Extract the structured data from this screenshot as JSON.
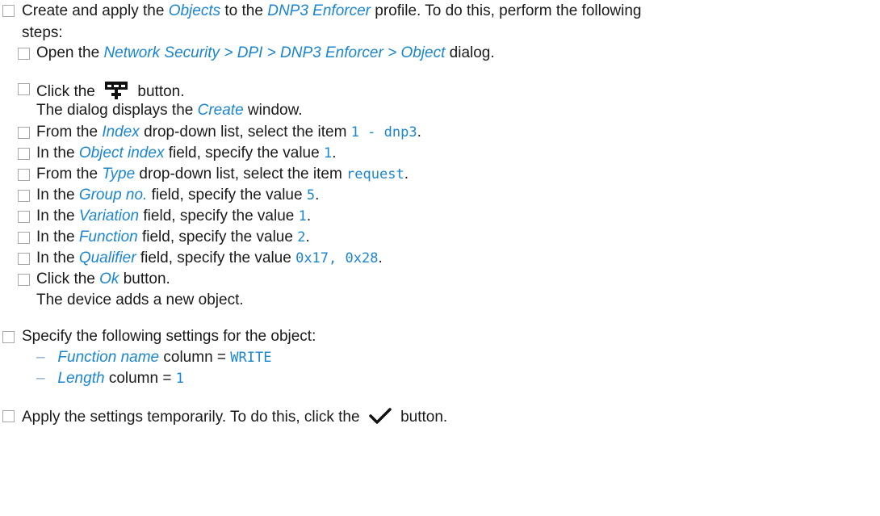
{
  "step1": {
    "line1_pre": "Create and apply the ",
    "line1_obj": "Objects",
    "line1_mid": " to the ",
    "line1_profile": "DNP3 Enforcer",
    "line1_post": " profile. To do this, perform the following",
    "line2": "steps:"
  },
  "substeps": {
    "open": {
      "pre": "Open the ",
      "path": "Network Security > DPI > DNP3 Enforcer > Object",
      "post": " dialog."
    },
    "click_add": {
      "pre": "Click the ",
      "post": " button.",
      "icon": "add-row-icon"
    },
    "dialog_note": {
      "pre": "The dialog displays the ",
      "name": "Create",
      "post": " window."
    },
    "index": {
      "pre": "From the ",
      "field": "Index",
      "mid": " drop-down list, select the item ",
      "value": "1 - dnp3",
      "post": "."
    },
    "object_index": {
      "pre": "In the ",
      "field": "Object index",
      "mid": " field, specify the value ",
      "value": "1",
      "post": "."
    },
    "type": {
      "pre": "From the ",
      "field": "Type",
      "mid": " drop-down list, select the item ",
      "value": "request",
      "post": "."
    },
    "group": {
      "pre": "In the ",
      "field": "Group no.",
      "mid": " field, specify the value ",
      "value": "5",
      "post": "."
    },
    "variation": {
      "pre": "In the ",
      "field": "Variation",
      "mid": " field, specify the value ",
      "value": "1",
      "post": "."
    },
    "function": {
      "pre": "In the ",
      "field": "Function",
      "mid": " field, specify the value ",
      "value": "2",
      "post": "."
    },
    "qualifier": {
      "pre": "In the ",
      "field": "Qualifier",
      "mid": " field, specify the value ",
      "value": "0x17, 0x28",
      "post": "."
    },
    "ok": {
      "pre": "Click the ",
      "field": "Ok",
      "post": " button."
    },
    "result": "The device adds a new object."
  },
  "step2": {
    "text": "Specify the following settings for the object:",
    "items": [
      {
        "dash": "–",
        "col": "Function name",
        "mid": " column = ",
        "value": "WRITE"
      },
      {
        "dash": "–",
        "col": "Length",
        "mid": " column = ",
        "value": "1"
      }
    ]
  },
  "step3": {
    "pre": "Apply the settings temporarily. To do this, click the ",
    "post": " button.",
    "icon": "checkmark-icon"
  }
}
